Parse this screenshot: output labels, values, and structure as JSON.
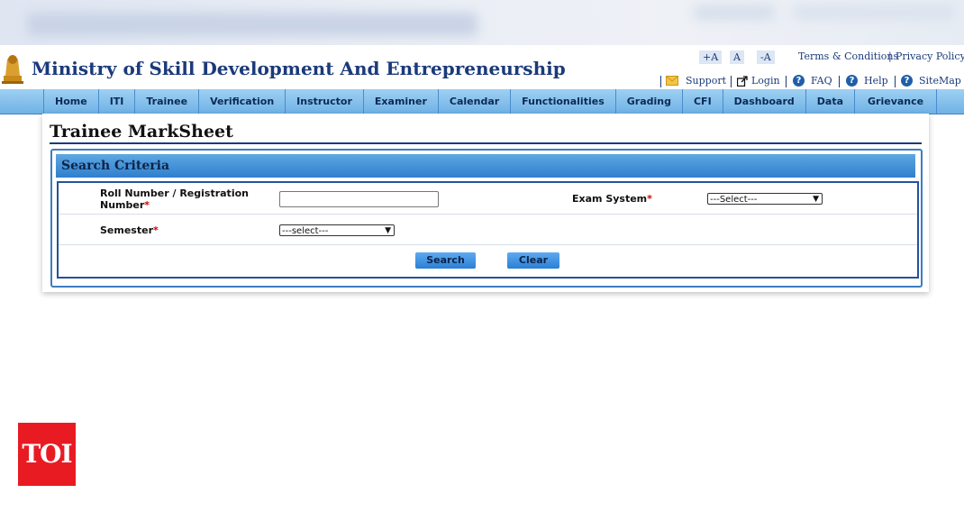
{
  "header": {
    "site_title": "Ministry of Skill Development And Entrepreneurship",
    "font_controls": [
      "+A",
      "A",
      "-A"
    ],
    "terms_label": "Terms & Conditions",
    "privacy_label": "Privacy Policy",
    "support_label": "Support",
    "login_label": "Login",
    "faq_label": "FAQ",
    "help_label": "Help",
    "sitemap_label": "SiteMap"
  },
  "nav": {
    "items": [
      "Home",
      "ITI",
      "Trainee",
      "Verification",
      "Instructor",
      "Examiner",
      "Calendar",
      "Functionalities",
      "Grading",
      "CFI",
      "Dashboard",
      "Data",
      "Grievance"
    ]
  },
  "page": {
    "title": "Trainee MarkSheet"
  },
  "search": {
    "header": "Search Criteria",
    "roll_label": "Roll Number / Registration Number",
    "roll_value": "",
    "exam_system_label": "Exam System",
    "exam_system_selected": "---Select---",
    "semester_label": "Semester",
    "semester_selected": "---select---",
    "required_marker": "*",
    "search_button": "Search",
    "clear_button": "Clear"
  },
  "watermark": {
    "logo_text": "TOI"
  },
  "colors": {
    "nav_bg": "#6fb2e6",
    "title_blue": "#1a3a7a",
    "required_red": "#d20000",
    "toi_red": "#e81b23"
  }
}
